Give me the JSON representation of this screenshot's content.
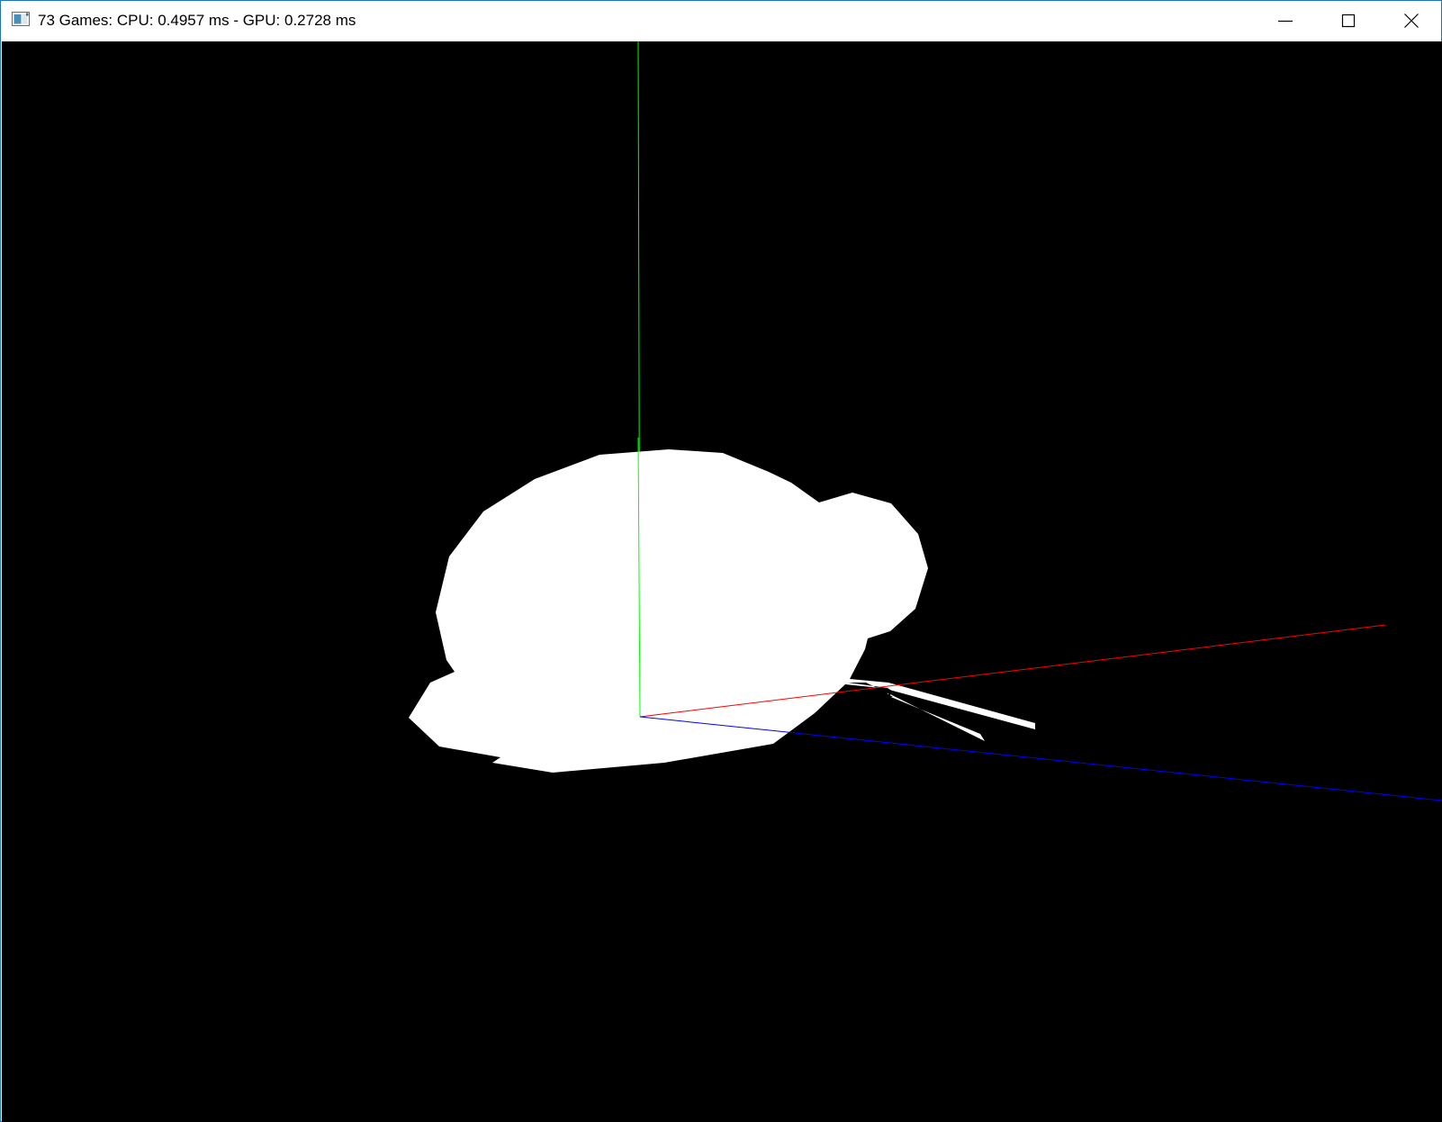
{
  "window": {
    "title": "73 Games: CPU: 0.4957 ms - GPU: 0.2728 ms",
    "icon": "application-icon",
    "controls": {
      "minimize_icon": "minimize-icon",
      "maximize_icon": "maximize-icon",
      "close_icon": "close-icon"
    }
  },
  "scene": {
    "background_color": "#000000",
    "model_color": "#ffffff",
    "axes": {
      "x_color": "#ff0000",
      "y_color": "#00ff00",
      "z_color": "#0000ff"
    }
  }
}
